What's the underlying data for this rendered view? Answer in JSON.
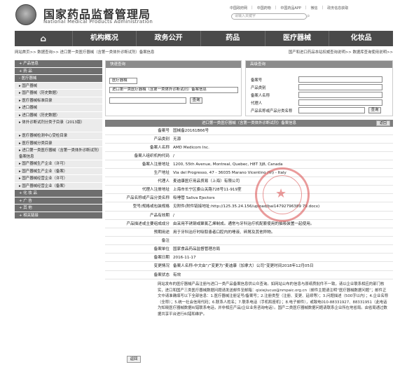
{
  "header": {
    "title": "国家药品监督管理局",
    "subtitle": "National Medical Products Administration",
    "toplinks": [
      "中国政府网",
      "中国药物",
      "中国药品APP",
      "微信",
      "政务信息获取"
    ],
    "search_placeholder": "请输入关键字"
  },
  "nav": [
    "机构概况",
    "政务公开",
    "药品",
    "医疗器械",
    "化妆品"
  ],
  "breadcrumb": {
    "left": "网站首页>> 数据查询>> 进口第一类医疗器械（含第一类体外诊断试剂）备案信息",
    "right": "国产和进口药品本站权威查询说明>>  数据库查询使用说明>>"
  },
  "sidebar": [
    {
      "type": "cat",
      "label": "+ 产品信息"
    },
    {
      "type": "cat",
      "label": "+ 药 品"
    },
    {
      "type": "cat",
      "label": "- 医疗器械"
    },
    {
      "type": "sub",
      "label": "▸ 国产器械"
    },
    {
      "type": "sub",
      "label": "▸ 国产器械（历史数据）"
    },
    {
      "type": "sub",
      "label": "▸ 医疗器械标准目录"
    },
    {
      "type": "sub",
      "label": "▸ 进口器械"
    },
    {
      "type": "sub",
      "label": "▸ 进口器械（历史数据）"
    },
    {
      "type": "sub",
      "label": "▸ 体外诊断试剂分类子目录（2013版）",
      "tall": true
    },
    {
      "type": "sub",
      "label": "▸ 医疗器械检测中心受检目录"
    },
    {
      "type": "sub",
      "label": "▸ 医疗器械分类目录"
    },
    {
      "type": "sub",
      "label": "▸ 进口第一类医疗器械（含第一类体外诊断试剂）备案信息",
      "tall": true
    },
    {
      "type": "sub",
      "label": "▸ 国产器械生产企业（许可）"
    },
    {
      "type": "sub",
      "label": "▸ 国产器械生产企业（备案）"
    },
    {
      "type": "sub",
      "label": "▸ 国产器械经营企业（许可）"
    },
    {
      "type": "sub",
      "label": "▸ 国产器械经营企业（备案）"
    },
    {
      "type": "cat",
      "label": "+ 化 妆 品"
    },
    {
      "type": "cat",
      "label": "+ 广 告"
    },
    {
      "type": "cat",
      "label": "+ 其 他"
    },
    {
      "type": "cat",
      "label": "+ 相关链接"
    }
  ],
  "search_panel": {
    "title": "快速查询",
    "select1": "医疗器械",
    "select2": "进口第一类医疗器械（含第一类体外诊断试剂）备案信息",
    "button": "查询"
  },
  "advanced_panel": {
    "title": "高级查询",
    "fields": [
      "备案号",
      "产品类别",
      "备案人名称",
      "代理人",
      "产品名称或产品分类名称"
    ],
    "button": "查询"
  },
  "detail": {
    "title": "进口第一类医疗器械（含第一类体外诊断试剂）备案信息",
    "back_label": "返回",
    "rows": [
      {
        "label": "备案号",
        "value": "国械备20161B66号"
      },
      {
        "label": "产品类别",
        "value": "无源"
      },
      {
        "label": "备案人名称",
        "value": "AMD Medicom Inc."
      },
      {
        "label": "备案人组织机构代码",
        "value": "/"
      },
      {
        "label": "备案人注册地址",
        "value": "1200, 55th Avenue, Montreal, Quebec, H8T 3J8, Canada"
      },
      {
        "label": "生产地址",
        "value": "Via del Progresso, 47 - 36035 Marano Vicentino (Vi) - Italy"
      },
      {
        "label": "代理人",
        "value": "麦迪康医疗用品贸易（上海）有限公司"
      },
      {
        "label": "代理人注册地址",
        "value": "上海市长宁区娄山关路728号11-919室"
      },
      {
        "label": "产品名称或产品分类名称",
        "value": "吸唾管 Saliva Ejectors"
      },
      {
        "label": "型号/规格或包装规格",
        "value": "见附件(附件链接地址:http://125.35.24.156/upload/bai14792796389 79.docx)"
      },
      {
        "label": "产品有效期",
        "value": "/"
      },
      {
        "label": "产品描述或主要组成成分",
        "value": "由采用不锈钢或聚氯乙烯制成。通常与牙科治疗机配套使用的抽吸装置一起使用。"
      },
      {
        "label": "预期用途",
        "value": "用于牙科治疗时吸取患者口腔内的唾液、碎屑及其他异物。"
      },
      {
        "label": "备注",
        "value": ""
      },
      {
        "label": "备案单位",
        "value": "国家食品药品监督管理总局"
      },
      {
        "label": "备案日期",
        "value": "2016-11-17"
      },
      {
        "label": "变更情况",
        "value": "备案人名称-中文由“/”变更为“麦迪康（加拿大）公司”变更时间2018年12月05日"
      },
      {
        "label": "备案状态",
        "value": "有效"
      }
    ],
    "notes": "网站发布的医疗器械产品注册与进口一类产品备案信息供公众查询。如网站公布的信息与原纸质批件不一致，请以企业联系相应的部门核实，进口和国产三类医疗器械数据问题请发送邮件至邮箱：qixiejiucuo@nmpaic.org.cn（邮件主题请注明“医疗器械数据问题”；邮件正文中请准确填写以下全部信息：1.医疗器械注册证号/备案号；2.注册类型（注册、变更、延续等）；3.问题描述（500字以内）；4.企业名称（全称）；5.统一社会信用代码；6.联系人姓名；7.联系电话（手机和座机）；8.电子邮件），或致电010-88331927、88331951（此电话为知晓医疗器械数据纠错联系电话，并非相应产品/企业业务咨询电话）。国产二类医疗器械数据问题请联系企业所在地省局。由省局通过数据共享平台进行纠错和维护。"
  }
}
